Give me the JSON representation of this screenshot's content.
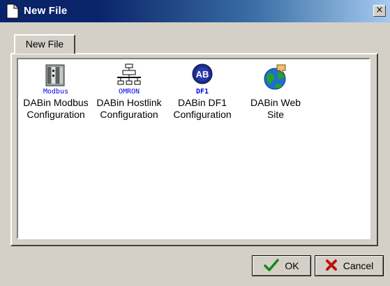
{
  "window": {
    "title": "New File",
    "close_label": "×"
  },
  "tabs": [
    {
      "label": "New File"
    }
  ],
  "items": [
    {
      "label": "DABin Modbus\nConfiguration",
      "icon": "modbus-icon",
      "icon_caption": "Modbus"
    },
    {
      "label": "DABin Hostlink\nConfiguration",
      "icon": "omron-icon",
      "icon_caption": "OMRON"
    },
    {
      "label": "DABin DF1\nConfiguration",
      "icon": "allen-bradley-df1-icon",
      "icon_badge": "AB",
      "icon_caption": "DF1"
    },
    {
      "label": "DABin Web\nSite",
      "icon": "web-globe-icon"
    }
  ],
  "buttons": {
    "ok": "OK",
    "cancel": "Cancel"
  },
  "colors": {
    "title_active": "#0a246a",
    "face": "#d4d0c8",
    "caption_blue": "#0000ee"
  }
}
